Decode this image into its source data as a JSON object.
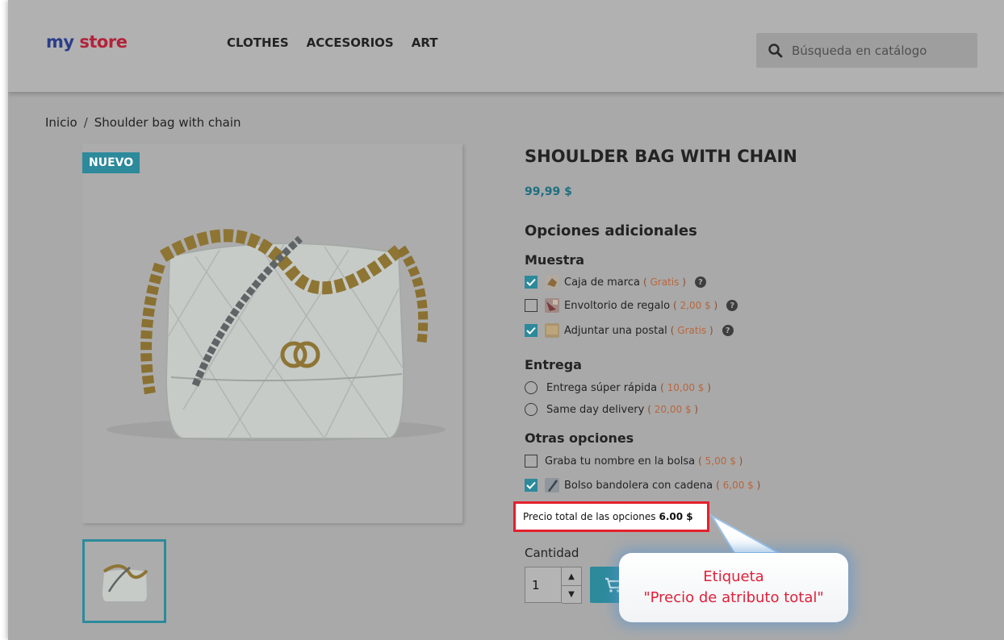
{
  "header": {
    "logo_part1": "my",
    "logo_part2": "store",
    "nav": [
      "CLOTHES",
      "ACCESORIOS",
      "ART"
    ],
    "search_placeholder": "Búsqueda en catálogo"
  },
  "breadcrumb": {
    "home": "Inicio",
    "separator": "/",
    "current": "Shoulder bag with chain"
  },
  "product": {
    "badge": "NUEVO",
    "title": "SHOULDER BAG WITH CHAIN",
    "price": "99,99 $"
  },
  "options": {
    "heading": "Opciones adicionales",
    "groups": [
      {
        "title": "Muestra",
        "items": [
          {
            "label": "Caja de marca",
            "price": "Gratis",
            "checked": true
          },
          {
            "label": "Envoltorio de regalo",
            "price": "2,00 $",
            "checked": false
          },
          {
            "label": "Adjuntar una postal",
            "price": "Gratis",
            "checked": true
          }
        ]
      },
      {
        "title": "Entrega",
        "items": [
          {
            "label": "Entrega súper rápida",
            "price": "10,00 $",
            "checked": false
          },
          {
            "label": "Same day delivery",
            "price": "20,00 $",
            "checked": false
          }
        ]
      },
      {
        "title": "Otras opciones",
        "items": [
          {
            "label": "Graba tu nombre en la bolsa",
            "price": "5,00 $",
            "checked": false
          },
          {
            "label": "Bolso bandolera con cadena",
            "price": "6,00 $",
            "checked": true
          }
        ]
      }
    ],
    "total_label": "Precio total de las opciones",
    "total_value": "6.00 $"
  },
  "quantity": {
    "label": "Cantidad",
    "value": "1"
  },
  "callout": {
    "line1": "Etiqueta",
    "line2": "\"Precio de atributo total\""
  },
  "colors": {
    "accent": "#2c8a9b",
    "price_option": "#b8673e",
    "highlight_border": "#e4202e",
    "callout_text": "#e0203a"
  }
}
